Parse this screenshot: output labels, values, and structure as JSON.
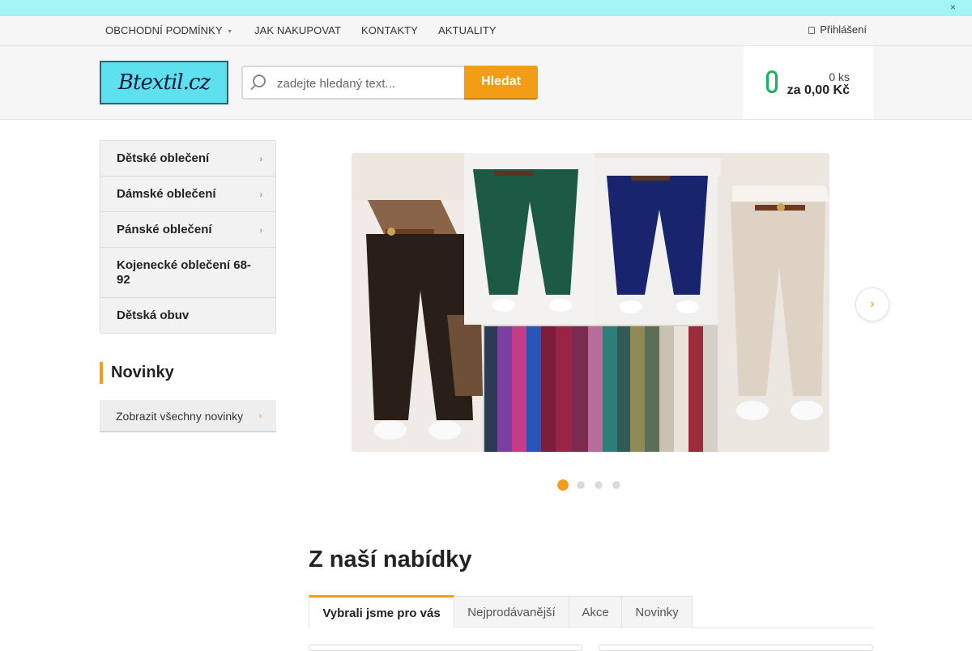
{
  "topstrip": {
    "close_icon": "close-icon"
  },
  "nav": {
    "items": [
      {
        "label": "OBCHODNÍ PODMÍNKY",
        "caret": "▾"
      },
      {
        "label": "JAK NAKUPOVAT"
      },
      {
        "label": "KONTAKTY"
      },
      {
        "label": "AKTUALITY"
      }
    ],
    "login_label": "Přihlášení"
  },
  "header": {
    "logo_text": "Btextil.cz",
    "search_placeholder": "zadejte hledaný text...",
    "search_button": "Hledat",
    "cart_qty": "0 ks",
    "cart_total": "za 0,00 Kč"
  },
  "sidebar": {
    "categories": [
      {
        "label": "Dětské oblečení",
        "has_sub": true
      },
      {
        "label": "Dámské oblečení",
        "has_sub": true
      },
      {
        "label": "Pánské oblečení",
        "has_sub": true
      },
      {
        "label": "Kojenecké oblečení 68-92",
        "has_sub": false
      },
      {
        "label": "Dětská obuv",
        "has_sub": false
      }
    ],
    "novinky_heading": "Novinky",
    "novinky_button": "Zobrazit všechny novinky"
  },
  "slider": {
    "active_slide": 1,
    "slide_count": 4,
    "next_icon": "chevron-right-icon"
  },
  "offer": {
    "title": "Z naší nabídky",
    "tabs": [
      {
        "label": "Vybrali jsme pro vás",
        "active": true
      },
      {
        "label": "Nejprodávanější",
        "active": false
      },
      {
        "label": "Akce",
        "active": false
      },
      {
        "label": "Novinky",
        "active": false
      }
    ]
  },
  "colors": {
    "accent": "#f39d16",
    "topstrip": "#a3f5f4",
    "cart_icon": "#17b35a"
  }
}
